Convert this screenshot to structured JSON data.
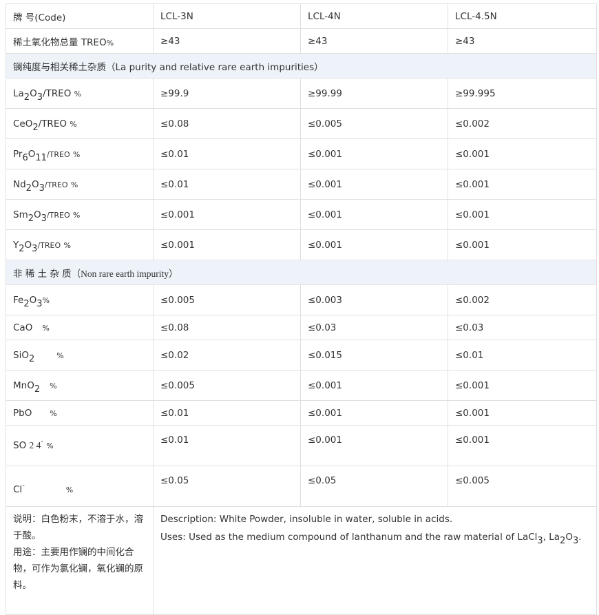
{
  "header": {
    "code": "牌 号(Code)",
    "cols": [
      "LCL-3N",
      "LCL-4N",
      "LCL-4.5N"
    ]
  },
  "treo": {
    "label": "稀土氧化物总量 TREO",
    "pct": "%",
    "values": [
      "≥43",
      "≥43",
      "≥43"
    ]
  },
  "section1": {
    "title_cn": "镧纯度与相关稀土杂质",
    "title_en": "（La purity and relative rare earth impurities）"
  },
  "re_rows": [
    {
      "parts": [
        "La",
        "2",
        "O",
        "3",
        "/TREO"
      ],
      "values": [
        "≥99.9",
        "≥99.99",
        "≥99.995"
      ]
    },
    {
      "parts": [
        "CeO",
        "2",
        "/TREO"
      ],
      "values": [
        "≤0.08",
        "≤0.005",
        "≤0.002"
      ]
    },
    {
      "parts": [
        "Pr",
        "6",
        "O",
        "11",
        "/TREO"
      ],
      "values": [
        "≤0.01",
        "≤0.001",
        "≤0.001"
      ]
    },
    {
      "parts": [
        "Nd",
        "2",
        "O",
        "3",
        "/TREO"
      ],
      "values": [
        "≤0.01",
        "≤0.001",
        "≤0.001"
      ]
    },
    {
      "parts": [
        "Sm",
        "2",
        "O",
        "3",
        "/TREO"
      ],
      "values": [
        "≤0.001",
        "≤0.001",
        "≤0.001"
      ]
    },
    {
      "parts": [
        "Y",
        "2",
        "O",
        "3",
        "/TREO"
      ],
      "values": [
        "≤0.001",
        "≤0.001",
        "≤0.001"
      ]
    }
  ],
  "section2": {
    "title_cn": "非 稀 土 杂 质",
    "title_en": "（Non rare earth impurity）"
  },
  "nre_rows": [
    {
      "label": "Fe₂O₃",
      "values": [
        "≤0.005",
        "≤0.003",
        "≤0.002"
      ]
    },
    {
      "label": "CaO",
      "values": [
        "≤0.08",
        "≤0.03",
        "≤0.03"
      ]
    },
    {
      "label": "SiO₂",
      "values": [
        "≤0.02",
        "≤0.015",
        "≤0.01"
      ]
    },
    {
      "label": "MnO₂",
      "values": [
        "≤0.005",
        "≤0.001",
        "≤0.001"
      ]
    },
    {
      "label": "PbO",
      "values": [
        "≤0.01",
        "≤0.001",
        "≤0.001"
      ]
    },
    {
      "label": "SO 2 4 -",
      "values": [
        "≤0.01",
        "≤0.001",
        "≤0.001"
      ]
    },
    {
      "label": "Cl -",
      "values": [
        "≤0.05",
        "≤0.05",
        "≤0.005"
      ]
    }
  ],
  "pct": "%",
  "notes": {
    "cn_desc": "说明：白色粉末，不溶于水，溶于酸。",
    "cn_uses": "用途：主要用作镧的中间化合物，可作为氯化镧，氧化镧的原料。",
    "en_desc": "Description: White Powder, insoluble in water, soluble in acids.",
    "en_uses_prefix": "Uses: Used as the medium compound of lanthanum and the raw material of LaCl",
    "en_uses_sub1": "3",
    "en_uses_mid": ", La",
    "en_uses_sub2": "2",
    "en_uses_o": "O",
    "en_uses_sub3": "3",
    "en_uses_end": "."
  }
}
